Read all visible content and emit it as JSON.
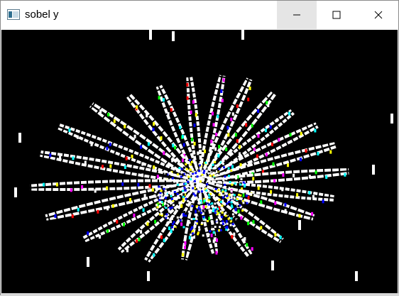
{
  "window": {
    "title": "sobel y"
  },
  "controls": {
    "minimize_icon": "minimize-icon",
    "maximize_icon": "maximize-icon",
    "close_icon": "close-icon"
  },
  "image": {
    "name": "sobel-y-edge-output",
    "background_color": "#000000",
    "edge_colors": [
      "#ffffff",
      "#ff00ff",
      "#00ffff",
      "#ffff00",
      "#00ff00",
      "#0000ff",
      "#ff0000"
    ]
  }
}
